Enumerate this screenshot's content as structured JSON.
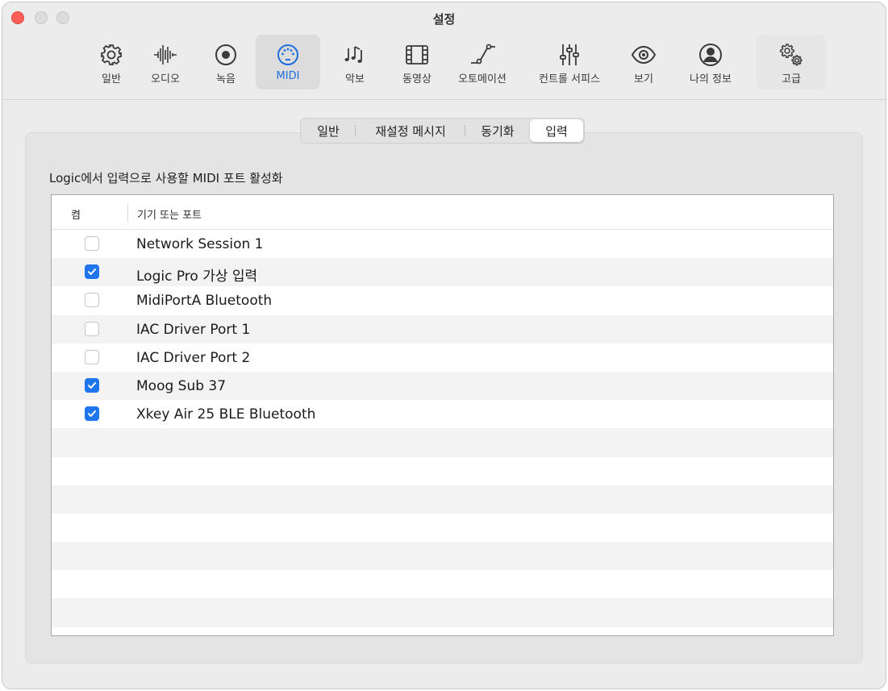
{
  "window": {
    "title": "설정"
  },
  "toolbar": {
    "items": [
      {
        "label": "일반",
        "icon": "gear-icon"
      },
      {
        "label": "오디오",
        "icon": "waveform-icon"
      },
      {
        "label": "녹음",
        "icon": "record-icon"
      },
      {
        "label": "MIDI",
        "icon": "midi-connector-icon",
        "selected": true
      },
      {
        "label": "악보",
        "icon": "music-notes-icon"
      },
      {
        "label": "동영상",
        "icon": "film-icon"
      },
      {
        "label": "오토메이션",
        "icon": "automation-curve-icon"
      },
      {
        "label": "컨트롤 서피스",
        "icon": "sliders-icon"
      },
      {
        "label": "보기",
        "icon": "eye-icon"
      },
      {
        "label": "나의 정보",
        "icon": "person-icon"
      },
      {
        "label": "고급",
        "icon": "gears-icon"
      }
    ]
  },
  "tabs": [
    {
      "label": "일반"
    },
    {
      "label": "재설정 메시지"
    },
    {
      "label": "동기화"
    },
    {
      "label": "입력",
      "active": true
    }
  ],
  "section_label": "Logic에서 입력으로 사용할 MIDI 포트 활성화",
  "table": {
    "columns": [
      "켬",
      "기기 또는 포트"
    ],
    "rows": [
      {
        "on": false,
        "name": "Network Session 1"
      },
      {
        "on": true,
        "name": "Logic Pro 가상 입력"
      },
      {
        "on": false,
        "name": "MidiPortA Bluetooth"
      },
      {
        "on": false,
        "name": "IAC Driver Port 1"
      },
      {
        "on": false,
        "name": "IAC Driver Port 2"
      },
      {
        "on": true,
        "name": "Moog Sub 37"
      },
      {
        "on": true,
        "name": "Xkey Air 25 BLE Bluetooth"
      }
    ]
  },
  "colors": {
    "accent": "#1f75ec",
    "selected_tab_text": "#1f6fe0",
    "close": "#fe5f57"
  }
}
